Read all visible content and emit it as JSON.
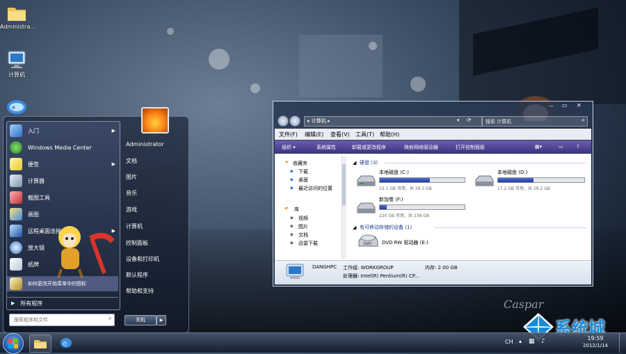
{
  "desktop": {
    "icons": [
      {
        "label": "Administra...",
        "icon": "folder-icon"
      },
      {
        "label": "计算机",
        "icon": "computer-icon"
      }
    ],
    "watermark": "系统城",
    "signature": "Caspar"
  },
  "start_menu": {
    "pinned": [
      {
        "label": "入门",
        "arrow": "▶"
      },
      {
        "label": "Windows Media Center",
        "arrow": ""
      },
      {
        "label": "便签",
        "arrow": "▶"
      },
      {
        "label": "计算器",
        "arrow": ""
      },
      {
        "label": "截图工具",
        "arrow": ""
      },
      {
        "label": "画图",
        "arrow": ""
      },
      {
        "label": "远程桌面连接",
        "arrow": "▶"
      },
      {
        "label": "放大镜",
        "arrow": ""
      },
      {
        "label": "纸牌",
        "arrow": ""
      },
      {
        "label": "如何更改开始菜单中的图标",
        "arrow": ""
      }
    ],
    "all_programs": "所有程序",
    "search_placeholder": "搜索程序和文件",
    "right_items": [
      "Administrator",
      "文档",
      "图片",
      "音乐",
      "游戏",
      "计算机",
      "控制面板",
      "设备和打印机",
      "默认程序",
      "帮助和支持"
    ],
    "shutdown_label": "关机",
    "shutdown_arrow": "▶"
  },
  "explorer": {
    "breadcrumb": "▸ 计算机 ▸",
    "search_placeholder": "搜索 计算机",
    "menu": [
      "文件(F)",
      "编辑(E)",
      "查看(V)",
      "工具(T)",
      "帮助(H)"
    ],
    "toolbar": [
      "组织 ▾",
      "系统属性",
      "卸载或更改程序",
      "映射网络驱动器",
      "打开控制面板"
    ],
    "nav": {
      "favorites": "收藏夹",
      "favorites_items": [
        "下载",
        "桌面",
        "最近访问的位置"
      ],
      "libraries": "库",
      "library_items": [
        "视频",
        "图片",
        "文档",
        "迅雷下载"
      ]
    },
    "hard_disks": {
      "header": "硬盘 (3)",
      "drives": [
        {
          "name": "本地磁盘 (C:)",
          "space": "12.1 GB 可用，共 29.3 GB",
          "used_fraction": 0.59
        },
        {
          "name": "本地磁盘 (D:)",
          "space": "17.2 GB 可用，共 29.2 GB",
          "used_fraction": 0.41
        },
        {
          "name": "新加卷 (F:)",
          "space": "220 GB 可用，共 238 GB",
          "used_fraction": 0.08
        }
      ]
    },
    "removable": {
      "header": "有可移动存储的设备 (1)",
      "drive": "DVD RW 驱动器 (E:)"
    },
    "details": {
      "computer_name": "DANGHPC",
      "workgroup": "工作组: WORKGROUP",
      "memory": "内存: 2.00 GB",
      "processor": "处理器: Intel(R) Pentium(R) CP..."
    }
  },
  "taskbar": {
    "time": "19:59",
    "date": "2012/1/14"
  },
  "colors": {
    "toolbar_purple": "#4a3f8f",
    "bar_blue": "#2f48b0",
    "watermark_blue": "#1a8ad8"
  }
}
